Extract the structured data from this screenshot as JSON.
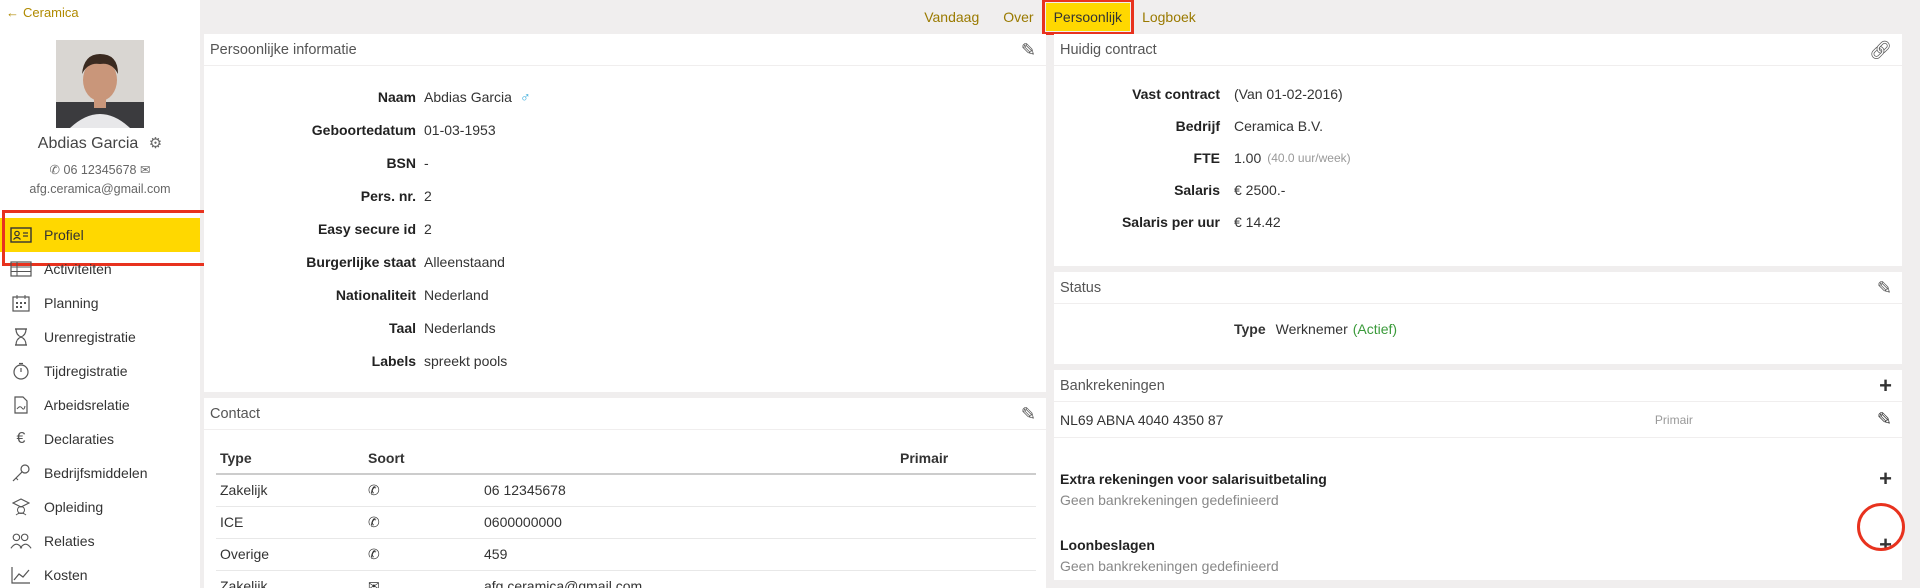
{
  "sidebar": {
    "back_label": "Ceramica",
    "user_name": "Abdias Garcia",
    "phone": "06 12345678",
    "email": "afg.ceramica@gmail.com",
    "items": [
      {
        "label": "Profiel",
        "icon": "id-card-icon"
      },
      {
        "label": "Activiteiten",
        "icon": "table-icon"
      },
      {
        "label": "Planning",
        "icon": "calendar-icon"
      },
      {
        "label": "Urenregistratie",
        "icon": "hourglass-icon"
      },
      {
        "label": "Tijdregistratie",
        "icon": "stopwatch-icon"
      },
      {
        "label": "Arbeidsrelatie",
        "icon": "document-icon"
      },
      {
        "label": "Declaraties",
        "icon": "euro-icon"
      },
      {
        "label": "Bedrijfsmiddelen",
        "icon": "key-icon"
      },
      {
        "label": "Opleiding",
        "icon": "graduation-icon"
      },
      {
        "label": "Relaties",
        "icon": "people-icon"
      },
      {
        "label": "Kosten",
        "icon": "chart-icon"
      }
    ]
  },
  "topnav": {
    "tabs": [
      "Vandaag",
      "Over",
      "Persoonlijk",
      "Logboek"
    ],
    "active": "Persoonlijk"
  },
  "personal": {
    "title": "Persoonlijke informatie",
    "fields": [
      {
        "label": "Naam",
        "value": "Abdias Garcia"
      },
      {
        "label": "Geboortedatum",
        "value": "01-03-1953"
      },
      {
        "label": "BSN",
        "value": "-"
      },
      {
        "label": "Pers. nr.",
        "value": "2"
      },
      {
        "label": "Easy secure id",
        "value": "2"
      },
      {
        "label": "Burgerlijke staat",
        "value": "Alleenstaand"
      },
      {
        "label": "Nationaliteit",
        "value": "Nederland"
      },
      {
        "label": "Taal",
        "value": "Nederlands"
      },
      {
        "label": "Labels",
        "value": "spreekt pools"
      }
    ],
    "gender_symbol": "♂"
  },
  "contact": {
    "title": "Contact",
    "headers": [
      "Type",
      "Soort",
      "",
      "Primair"
    ],
    "rows": [
      {
        "type": "Zakelijk",
        "kind": "phone-icon",
        "value": "06 12345678"
      },
      {
        "type": "ICE",
        "kind": "phone-icon",
        "value": "0600000000"
      },
      {
        "type": "Overige",
        "kind": "phone-icon",
        "value": "459"
      },
      {
        "type": "Zakelijk",
        "kind": "mail-icon",
        "value": "afg.ceramica@gmail.com"
      }
    ]
  },
  "contract": {
    "title": "Huidig contract",
    "fields": [
      {
        "label": "Vast contract",
        "value": "(Van 01-02-2016)"
      },
      {
        "label": "Bedrijf",
        "value": "Ceramica B.V."
      },
      {
        "label": "FTE",
        "value": "1.00",
        "note": "(40.0 uur/week)"
      },
      {
        "label": "Salaris",
        "value": "€ 2500.-"
      },
      {
        "label": "Salaris per uur",
        "value": "€ 14.42"
      }
    ]
  },
  "status": {
    "title": "Status",
    "label": "Type",
    "value": "Werknemer",
    "state": "(Actief)"
  },
  "bank": {
    "title": "Bankrekeningen",
    "account": "NL69 ABNA 4040 4350 87",
    "account_tag": "Primair",
    "extra_title": "Extra rekeningen voor salarisuitbetaling",
    "extra_empty": "Geen bankrekeningen gedefinieerd",
    "loon_title": "Loonbeslagen",
    "loon_empty": "Geen bankrekeningen gedefinieerd"
  }
}
